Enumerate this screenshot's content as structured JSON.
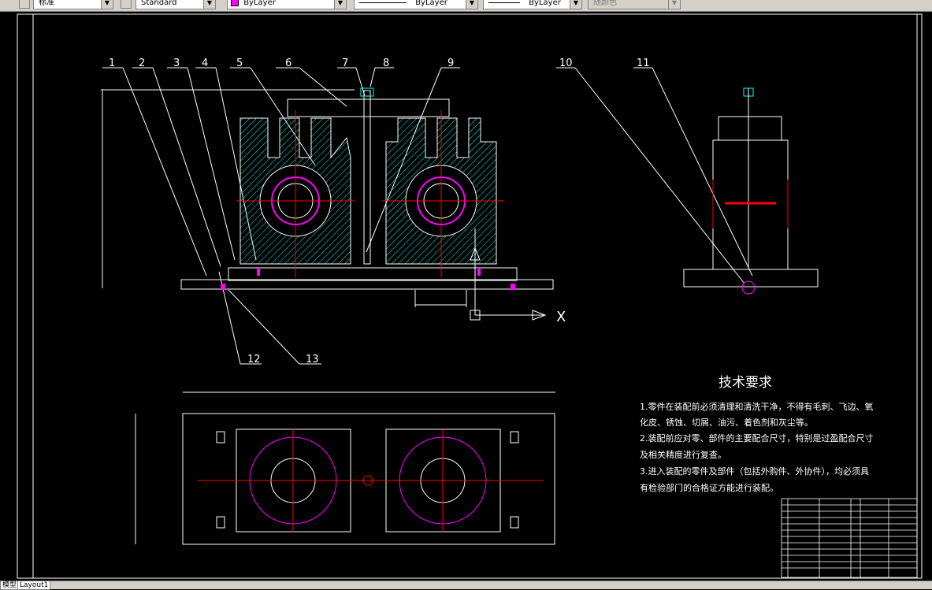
{
  "toolbar": {
    "textstyle_value": "标准",
    "dimstyle_value": "Standard",
    "layer_value": "ByLayer",
    "linetype_value": "ByLayer",
    "lineweight_value": "ByLayer",
    "plotstyle_value": "随颜色"
  },
  "drawing": {
    "balloons": [
      "1",
      "2",
      "3",
      "4",
      "5",
      "6",
      "7",
      "8",
      "9",
      "10",
      "11",
      "12",
      "13"
    ],
    "axis_x_label": "X",
    "tech_title": "技术要求",
    "tech_lines": [
      "1.零件在装配前必须清理和清洗干净，不得有毛刺、飞边、氧",
      "化皮、锈蚀、切屑、油污、着色剂和灰尘等。",
      "2.装配前应对零、部件的主要配合尺寸，特别是过盈配合尺寸",
      "及相关精度进行复查。",
      "3.进入装配的零件及部件（包括外购件、外协件），均必须具",
      "有检验部门的合格证方能进行装配。"
    ]
  },
  "tabs": {
    "model_label": "模型",
    "layout1_label": "Layout1"
  },
  "colors": {
    "background": "#000000",
    "outline": "#ffffff",
    "hatch": "#00ffff",
    "centerline": "#ff0000",
    "holes": "#ff00ff",
    "accent": "#ffff00"
  }
}
